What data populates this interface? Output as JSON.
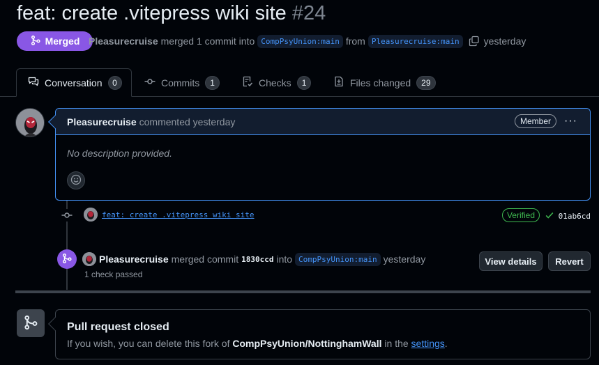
{
  "pr": {
    "title": "feat: create .vitepress wiki site",
    "number": "#24",
    "state": "Merged",
    "author": "Pleasurecruise",
    "merged_text": "merged 1 commit into",
    "base_branch": "CompPsyUnion:main",
    "from_text": "from",
    "head_branch": "Pleasurecruise:main",
    "time": "yesterday"
  },
  "tabs": [
    {
      "label": "Conversation",
      "count": "0",
      "icon": "comment-discussion-icon"
    },
    {
      "label": "Commits",
      "count": "1",
      "icon": "git-commit-icon"
    },
    {
      "label": "Checks",
      "count": "1",
      "icon": "checklist-icon"
    },
    {
      "label": "Files changed",
      "count": "29",
      "icon": "file-diff-icon"
    }
  ],
  "comment": {
    "author": "Pleasurecruise",
    "action": "commented yesterday",
    "badge": "Member",
    "menu": "···",
    "body": "No description provided."
  },
  "commit": {
    "message": "feat: create .vitepress wiki site",
    "verified": "Verified",
    "sha": "01ab6cd"
  },
  "merge_event": {
    "author": "Pleasurecruise",
    "action": "merged commit",
    "sha": "1830ccd",
    "into": "into",
    "branch": "CompPsyUnion:main",
    "time": "yesterday",
    "checks": "1 check passed",
    "view_details": "View details",
    "revert": "Revert"
  },
  "closed": {
    "title": "Pull request closed",
    "text_before": "If you wish, you can delete this fork of",
    "repo": "CompPsyUnion/NottinghamWall",
    "text_mid": "in the",
    "link": "settings",
    "text_end": "."
  },
  "colors": {
    "merged": "#8957e5",
    "link": "#4493f8",
    "verified": "#3fb950",
    "background": "#010409"
  }
}
